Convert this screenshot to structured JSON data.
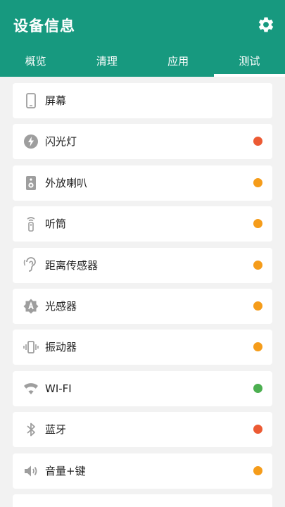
{
  "header": {
    "title": "设备信息",
    "settings_icon": "gear-icon"
  },
  "tabs": [
    {
      "label": "概览",
      "active": false
    },
    {
      "label": "清理",
      "active": false
    },
    {
      "label": "应用",
      "active": false
    },
    {
      "label": "测试",
      "active": true
    }
  ],
  "status_colors": {
    "red": "#ec5a33",
    "orange": "#f59c1a",
    "green": "#4caf50"
  },
  "items": [
    {
      "label": "屏幕",
      "icon": "phone-screen-icon",
      "status": null
    },
    {
      "label": "闪光灯",
      "icon": "flash-icon",
      "status": "red"
    },
    {
      "label": "外放喇叭",
      "icon": "speaker-icon",
      "status": "orange"
    },
    {
      "label": "听筒",
      "icon": "earpiece-icon",
      "status": "orange"
    },
    {
      "label": "距离传感器",
      "icon": "proximity-ear-icon",
      "status": "orange"
    },
    {
      "label": "光感器",
      "icon": "light-sensor-icon",
      "status": "orange"
    },
    {
      "label": "振动器",
      "icon": "vibration-icon",
      "status": "orange"
    },
    {
      "label": "WI-FI",
      "icon": "wifi-icon",
      "status": "green"
    },
    {
      "label": "蓝牙",
      "icon": "bluetooth-icon",
      "status": "red"
    },
    {
      "label": "音量+键",
      "icon": "volume-icon",
      "status": "orange"
    }
  ]
}
